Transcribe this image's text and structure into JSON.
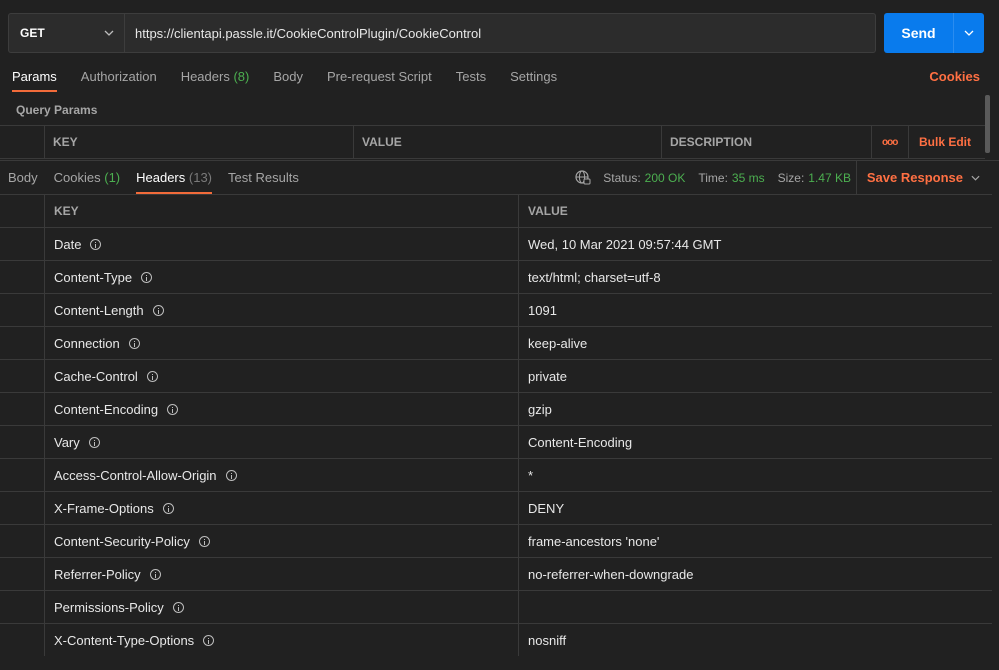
{
  "request": {
    "method": "GET",
    "url": "https://clientapi.passle.it/CookieControlPlugin/CookieControl",
    "send_label": "Send"
  },
  "request_tabs": [
    {
      "label": "Params"
    },
    {
      "label": "Authorization"
    },
    {
      "label": "Headers",
      "count": "(8)"
    },
    {
      "label": "Body"
    },
    {
      "label": "Pre-request Script"
    },
    {
      "label": "Tests"
    },
    {
      "label": "Settings"
    }
  ],
  "cookies_link": "Cookies",
  "query_params_title": "Query Params",
  "params_table": {
    "key": "KEY",
    "value": "VALUE",
    "description": "DESCRIPTION",
    "more": "ooo",
    "bulk_edit": "Bulk Edit"
  },
  "response_tabs": [
    {
      "label": "Body"
    },
    {
      "label": "Cookies",
      "count": "(1)"
    },
    {
      "label": "Headers",
      "count": "(13)"
    },
    {
      "label": "Test Results"
    }
  ],
  "status": {
    "status_label": "Status:",
    "status_value": "200 OK",
    "time_label": "Time:",
    "time_value": "35 ms",
    "size_label": "Size:",
    "size_value": "1.47 KB"
  },
  "save_response": "Save Response",
  "headers_table": {
    "key_header": "KEY",
    "value_header": "VALUE",
    "rows": [
      {
        "key": "Date",
        "value": "Wed, 10 Mar 2021 09:57:44 GMT"
      },
      {
        "key": "Content-Type",
        "value": "text/html; charset=utf-8"
      },
      {
        "key": "Content-Length",
        "value": "1091"
      },
      {
        "key": "Connection",
        "value": "keep-alive"
      },
      {
        "key": "Cache-Control",
        "value": "private"
      },
      {
        "key": "Content-Encoding",
        "value": "gzip"
      },
      {
        "key": "Vary",
        "value": "Content-Encoding"
      },
      {
        "key": "Access-Control-Allow-Origin",
        "value": "*"
      },
      {
        "key": "X-Frame-Options",
        "value": "DENY"
      },
      {
        "key": "Content-Security-Policy",
        "value": "frame-ancestors 'none'"
      },
      {
        "key": "Referrer-Policy",
        "value": "no-referrer-when-downgrade"
      },
      {
        "key": "Permissions-Policy",
        "value": ""
      },
      {
        "key": "X-Content-Type-Options",
        "value": "nosniff"
      }
    ]
  },
  "colors": {
    "accent": "#f26b3a",
    "send": "#097bed",
    "success": "#4caf50"
  },
  "icons": {
    "globe": "globe-icon",
    "info": "info-icon",
    "chevron": "chevron-down-icon"
  }
}
